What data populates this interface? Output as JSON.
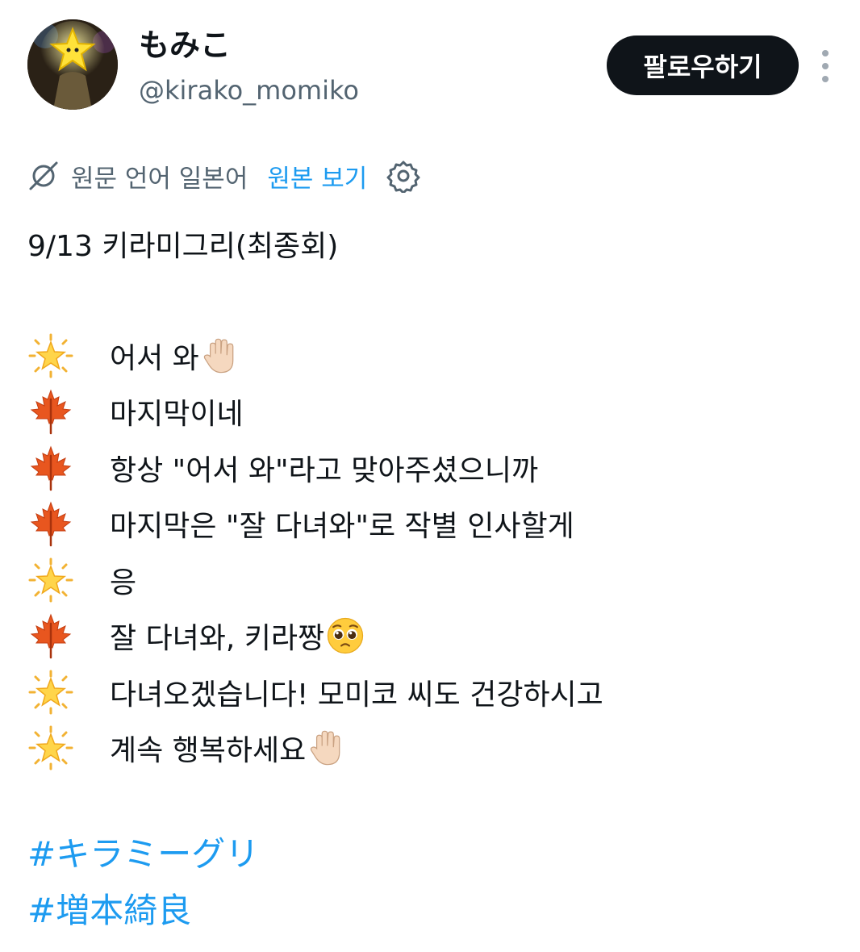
{
  "author": {
    "display_name": "もみこ",
    "handle": "@kirako_momiko"
  },
  "follow_button": {
    "label": "팔로우하기"
  },
  "more_button": {
    "icon": "more-vertical-icon"
  },
  "translation": {
    "original_language_label": "원문 언어 일본어",
    "show_original_label": "원본 보기",
    "icon": "translate-icon",
    "settings_icon": "gear-icon"
  },
  "tweet": {
    "title": "9/13 키라미그리(최종회)",
    "lines": [
      {
        "emoji": "glowing-star",
        "text": "어서 와",
        "trailing_emoji": "raised-hand"
      },
      {
        "emoji": "maple-leaf",
        "text": "마지막이네"
      },
      {
        "emoji": "maple-leaf",
        "text": "항상 \"어서 와\"라고 맞아주셨으니까"
      },
      {
        "emoji": "maple-leaf",
        "text": "마지막은 \"잘 다녀와\"로 작별 인사할게"
      },
      {
        "emoji": "glowing-star",
        "text": "응"
      },
      {
        "emoji": "maple-leaf",
        "text": "잘 다녀와, 키라짱",
        "trailing_emoji": "pleading-face"
      },
      {
        "emoji": "glowing-star",
        "text": "다녀오겠습니다! 모미코 씨도 건강하시고"
      },
      {
        "emoji": "glowing-star",
        "text": "계속 행복하세요",
        "trailing_emoji": "raised-hand"
      }
    ],
    "hashtags": [
      "#キラミーグリ",
      "#増本綺良"
    ]
  },
  "colors": {
    "text_primary": "#0f1419",
    "text_secondary": "#536471",
    "link": "#1d9bf0",
    "button_bg": "#0f1419"
  }
}
